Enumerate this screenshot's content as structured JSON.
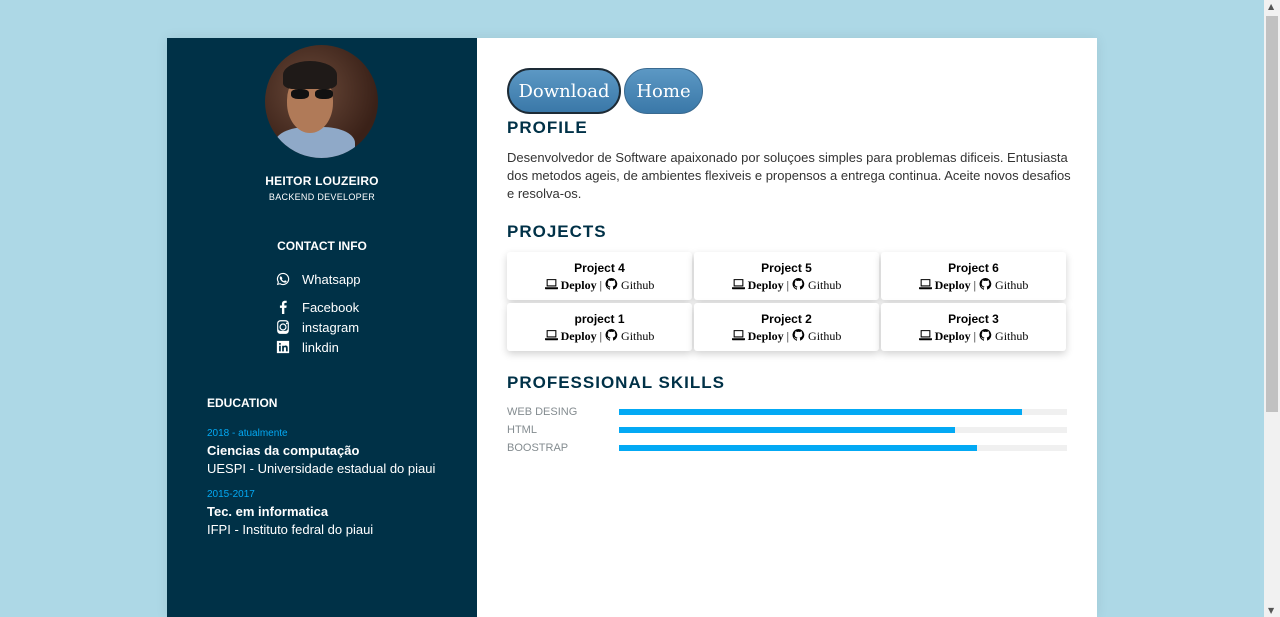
{
  "sidebar": {
    "name": "HEITOR LOUZEIRO",
    "role": "BACKEND DEVELOPER",
    "contact_title": "CONTACT INFO",
    "contacts": [
      {
        "label": "Whatsapp",
        "icon": "whatsapp-icon"
      },
      {
        "label": "Facebook",
        "icon": "facebook-icon"
      },
      {
        "label": "instagram",
        "icon": "instagram-icon"
      },
      {
        "label": "linkdin",
        "icon": "linkedin-icon"
      }
    ],
    "education_title": "EDUCATION",
    "education": [
      {
        "years": "2018 - atualmente",
        "course": "Ciencias da computação",
        "school": "UESPI - Universidade estadual do piaui"
      },
      {
        "years": "2015-2017",
        "course": "Tec. em informatica",
        "school": "IFPI - Instituto fedral do piaui"
      }
    ]
  },
  "buttons": {
    "download": "Download",
    "home": "Home"
  },
  "profile": {
    "title": "PROFILE",
    "text": "Desenvolvedor de Software apaixonado por soluçoes simples para problemas dificeis. Entusiasta dos metodos ageis, de ambientes flexiveis e propensos a entrega continua. Aceite novos desafios e resolva-os."
  },
  "projects": {
    "title": "PROJECTS",
    "deploy_label": "Deploy",
    "separator": "|",
    "github_label": "Github",
    "items": [
      {
        "name": "Project 4"
      },
      {
        "name": "Project 5"
      },
      {
        "name": "Project 6"
      },
      {
        "name": "project 1"
      },
      {
        "name": "Project 2"
      },
      {
        "name": "Project 3"
      }
    ]
  },
  "skills": {
    "title": "PROFESSIONAL SKILLS",
    "items": [
      {
        "label": "WEB DESING",
        "level": 0.9
      },
      {
        "label": "HTML",
        "level": 0.75
      },
      {
        "label": "BOOSTRAP",
        "level": 0.8
      }
    ]
  },
  "colors": {
    "page_bg": "#add8e6",
    "sidebar_bg": "#003147",
    "accent": "#03a9f4",
    "button": "#4a88b8"
  }
}
